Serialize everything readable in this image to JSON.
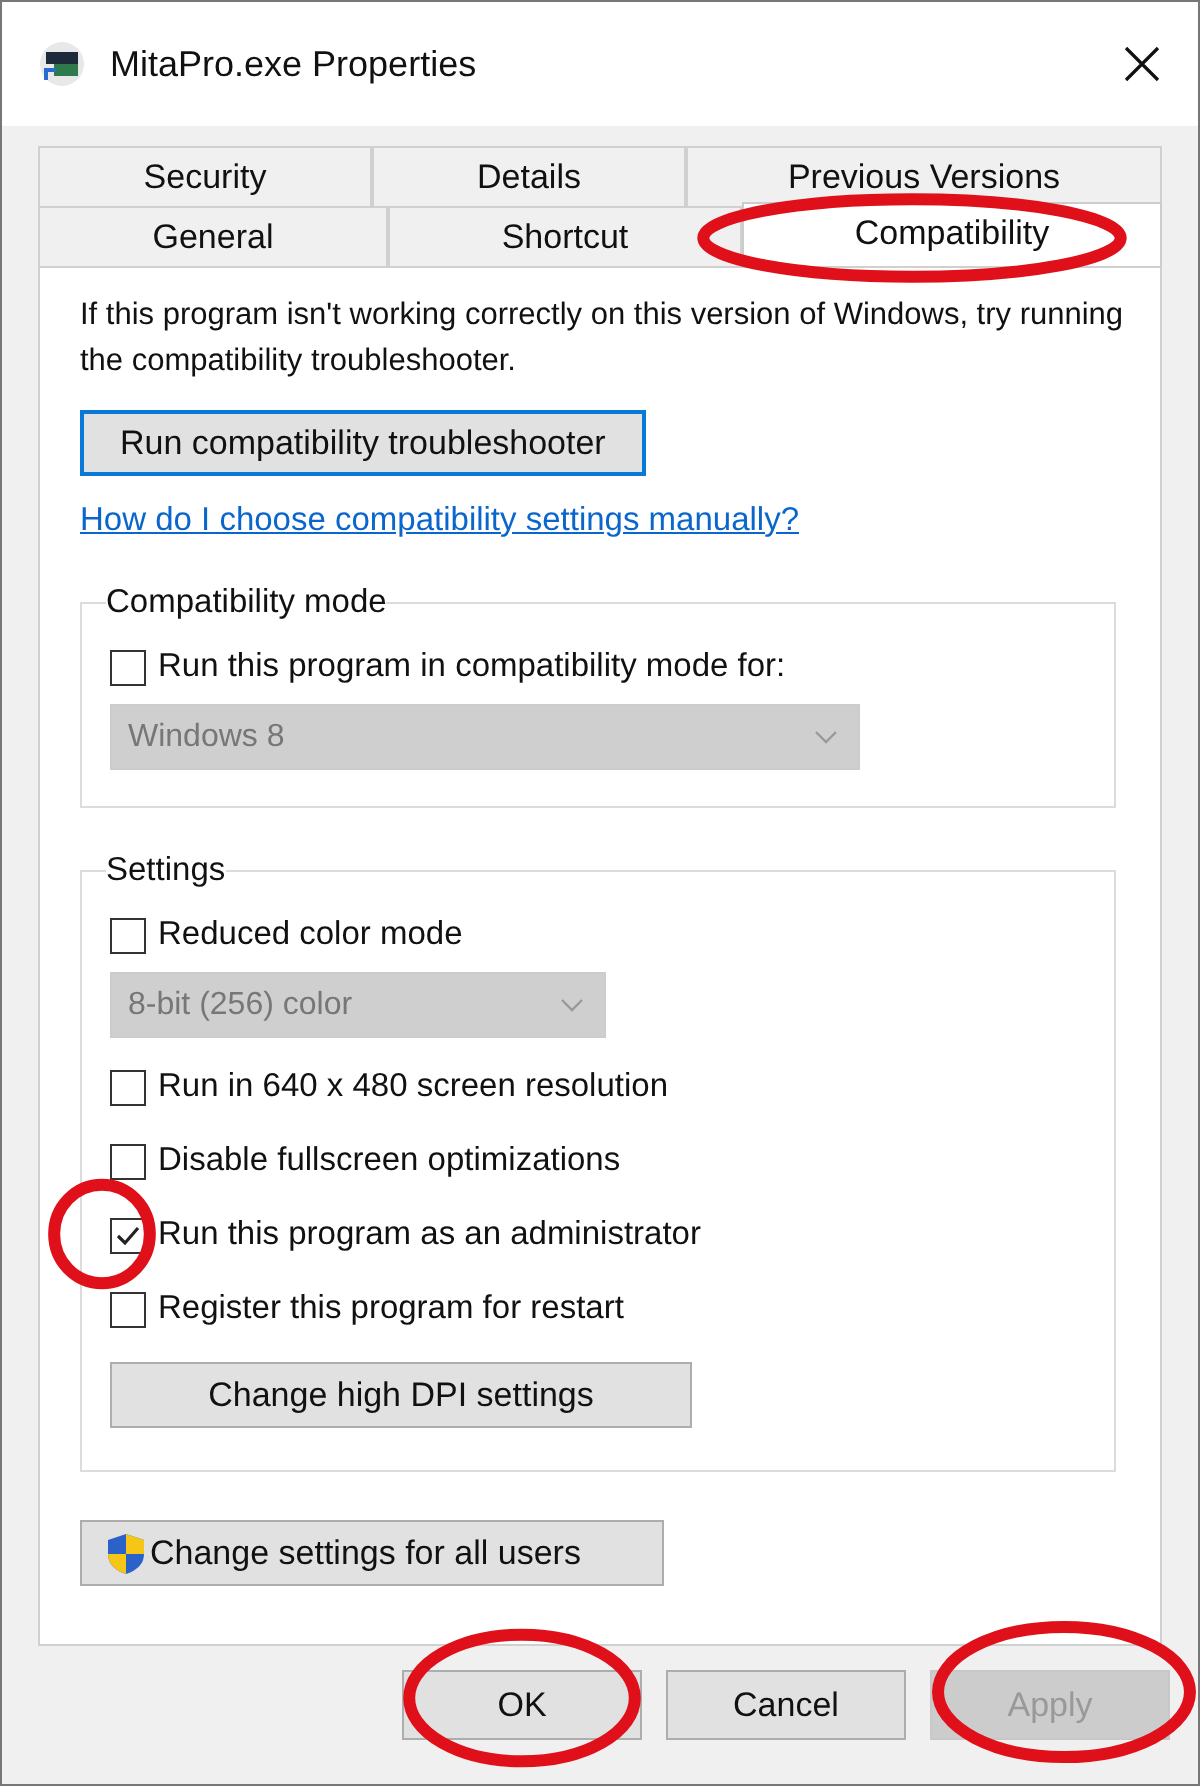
{
  "window": {
    "title": "MitaPro.exe Properties"
  },
  "tab_rows": [
    {
      "tabs": [
        {
          "label": "Security",
          "selected": false,
          "circled": false
        },
        {
          "label": "Details",
          "selected": false,
          "circled": false
        },
        {
          "label": "Previous Versions",
          "selected": false,
          "circled": false
        }
      ]
    },
    {
      "tabs": [
        {
          "label": "General",
          "selected": false,
          "circled": false
        },
        {
          "label": "Shortcut",
          "selected": false,
          "circled": false
        },
        {
          "label": "Compatibility",
          "selected": true,
          "circled": true
        }
      ]
    }
  ],
  "panel": {
    "intro": "If this program isn't working correctly on this version of Windows, try running the compatibility troubleshooter.",
    "troubleshooter_button": {
      "label": "Run compatibility troubleshooter",
      "focused": true
    },
    "help_link": "How do I choose compatibility settings manually?",
    "groups": [
      {
        "title": "Compatibility mode",
        "items": [
          {
            "kind": "checkbox",
            "label": "Run this program in compatibility mode for:",
            "checked": false,
            "circled": false
          },
          {
            "kind": "select",
            "value": "Windows 8",
            "disabled": true
          }
        ]
      },
      {
        "title": "Settings",
        "items": [
          {
            "kind": "checkbox",
            "label": "Reduced color mode",
            "checked": false,
            "circled": false
          },
          {
            "kind": "select",
            "value": "8-bit (256) color",
            "disabled": true
          },
          {
            "kind": "checkbox",
            "label": "Run in 640 x 480 screen resolution",
            "checked": false,
            "circled": false
          },
          {
            "kind": "checkbox",
            "label": "Disable fullscreen optimizations",
            "checked": false,
            "circled": false
          },
          {
            "kind": "checkbox",
            "label": "Run this program as an administrator",
            "checked": true,
            "circled": true
          },
          {
            "kind": "checkbox",
            "label": "Register this program for restart",
            "checked": false,
            "circled": false
          },
          {
            "kind": "button",
            "label": "Change high DPI settings"
          }
        ]
      }
    ],
    "all_users_button": "Change settings for all users"
  },
  "buttons": [
    {
      "label": "OK",
      "disabled": false,
      "circled": true
    },
    {
      "label": "Cancel",
      "disabled": false,
      "circled": false
    },
    {
      "label": "Apply",
      "disabled": true,
      "circled": true
    }
  ]
}
